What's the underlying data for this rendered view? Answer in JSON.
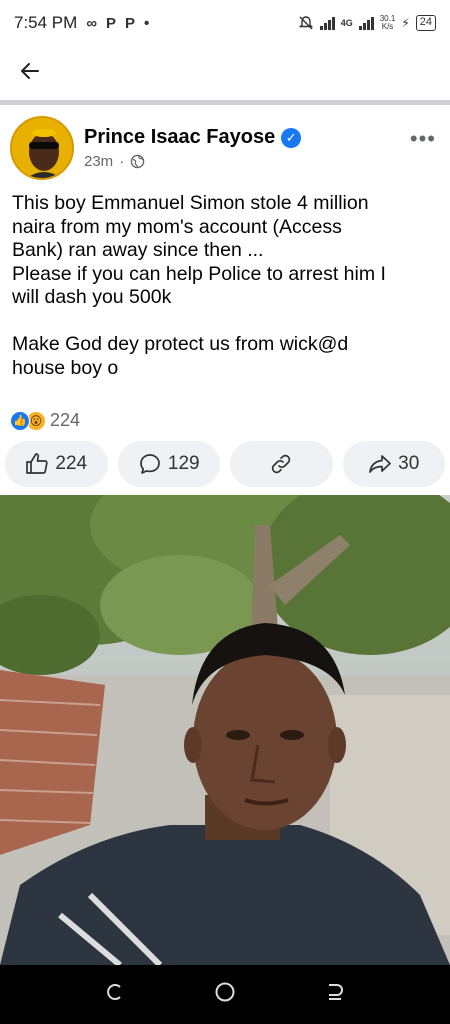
{
  "status_bar": {
    "time": "7:54 PM",
    "left_icons": [
      "∞",
      "P",
      "P",
      "•"
    ],
    "network": "4G",
    "speed_top": "30.1",
    "speed_bottom": "K/s",
    "battery": "24"
  },
  "post": {
    "author": "Prince Isaac Fayose",
    "time_ago": "23m",
    "separator": "·",
    "text_lines": [
      "This boy Emmanuel Simon stole 4 million",
      "naira from my mom's account (Access",
      "Bank) ran away since then ...",
      "Please if you can help Police to arrest him I",
      "will dash you 500k"
    ],
    "text_lines_2": [
      "Make God dey protect us from wick@d",
      "house boy o"
    ],
    "reaction_count": "224"
  },
  "actions": {
    "like_count": "224",
    "comment_count": "129",
    "share_count": "30"
  },
  "icons": {
    "back": "arrow-left-icon",
    "more": "more-horizontal-icon",
    "verified": "verified-badge-icon",
    "privacy": "globe-icon",
    "like": "thumbs-up-icon",
    "comment": "comment-bubble-icon",
    "copy_link": "link-icon",
    "share": "share-arrow-icon"
  },
  "colors": {
    "accent": "#1877f2",
    "action_bg": "#eff1f4",
    "wow": "#f7b125"
  }
}
